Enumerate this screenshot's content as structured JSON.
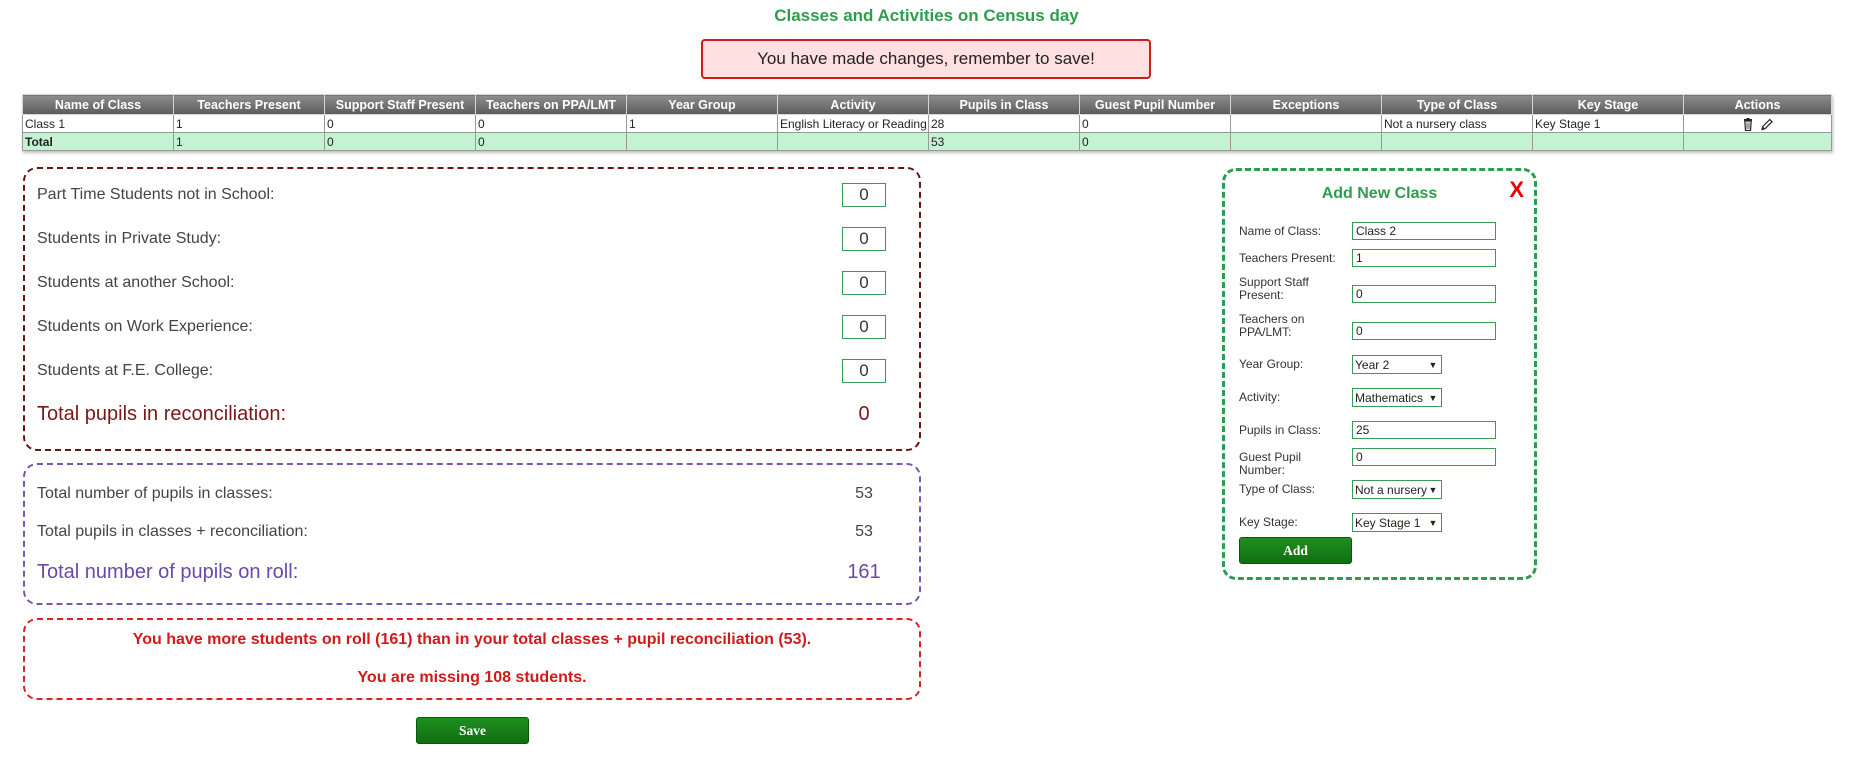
{
  "page": {
    "title": "Classes and Activities on Census day",
    "unsaved_message": "You have made changes, remember to save!"
  },
  "table": {
    "headers": [
      "Name of Class",
      "Teachers Present",
      "Support Staff Present",
      "Teachers on PPA/LMT",
      "Year Group",
      "Activity",
      "Pupils in Class",
      "Guest Pupil Number",
      "Exceptions",
      "Type of Class",
      "Key Stage",
      "Actions"
    ],
    "rows": [
      [
        "Class 1",
        "1",
        "0",
        "0",
        "1",
        "English Literacy or Reading",
        "28",
        "0",
        "",
        "Not a nursery class",
        "Key Stage 1"
      ]
    ],
    "total": [
      "Total",
      "1",
      "0",
      "0",
      "",
      "",
      "53",
      "0",
      "",
      "",
      ""
    ],
    "action_icons": [
      "trash-icon",
      "pencil-icon"
    ]
  },
  "reconciliation": {
    "items": [
      {
        "label": "Part Time Students not in School:",
        "value": "0"
      },
      {
        "label": "Students in Private Study:",
        "value": "0"
      },
      {
        "label": "Students at another School:",
        "value": "0"
      },
      {
        "label": "Students on Work Experience:",
        "value": "0"
      },
      {
        "label": "Students at F.E. College:",
        "value": "0"
      }
    ],
    "total_label": "Total pupils in reconciliation:",
    "total_value": "0"
  },
  "totals": {
    "classes_label": "Total number of pupils in classes:",
    "classes_value": "53",
    "combined_label": "Total pupils in classes + reconciliation:",
    "combined_value": "53",
    "roll_label": "Total number of pupils on roll:",
    "roll_value": "161"
  },
  "warning": {
    "line1": "You have more students on roll (161) than in your total classes + pupil reconciliation (53).",
    "line2": "You are missing 108 students."
  },
  "buttons": {
    "save": "Save",
    "add": "Add"
  },
  "add_class": {
    "title": "Add New Class",
    "close": "X",
    "name_label": "Name of Class:",
    "name_value": "Class 2",
    "teachers_label": "Teachers Present:",
    "teachers_value": "1",
    "support_label": "Support Staff Present:",
    "support_value": "0",
    "ppa_label": "Teachers on PPA/LMT:",
    "ppa_value": "0",
    "year_label": "Year Group:",
    "year_value": "Year 2",
    "activity_label": "Activity:",
    "activity_value": "Mathematics",
    "pupils_label": "Pupils in Class:",
    "pupils_value": "25",
    "guest_label": "Guest Pupil Number:",
    "guest_value": "0",
    "type_label": "Type of Class:",
    "type_value": "Not a nursery class",
    "stage_label": "Key Stage:",
    "stage_value": "Key Stage 1"
  },
  "colors": {
    "accent_green": "#2e9e4e",
    "warning_red": "#d11a1a",
    "reconciliation_maroon": "#6b1414",
    "totals_purple": "#6a4aa8",
    "total_row_bg": "#c5f2d2"
  }
}
